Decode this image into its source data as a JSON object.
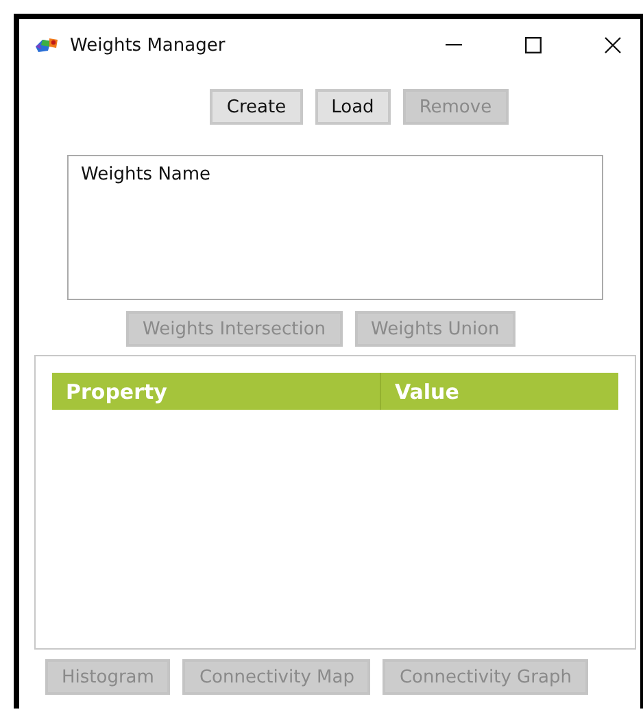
{
  "window": {
    "title": "Weights Manager"
  },
  "top_buttons": [
    {
      "label": "Create",
      "disabled": false
    },
    {
      "label": "Load",
      "disabled": false
    },
    {
      "label": "Remove",
      "disabled": true
    }
  ],
  "weights_list": {
    "header": "Weights Name"
  },
  "set_buttons": [
    {
      "label": "Weights Intersection",
      "disabled": true
    },
    {
      "label": "Weights Union",
      "disabled": true
    }
  ],
  "table": {
    "columns": [
      "Property",
      "Value"
    ]
  },
  "bottom_buttons": [
    {
      "label": "Histogram",
      "disabled": true
    },
    {
      "label": "Connectivity Map",
      "disabled": true
    },
    {
      "label": "Connectivity Graph",
      "disabled": true
    }
  ]
}
